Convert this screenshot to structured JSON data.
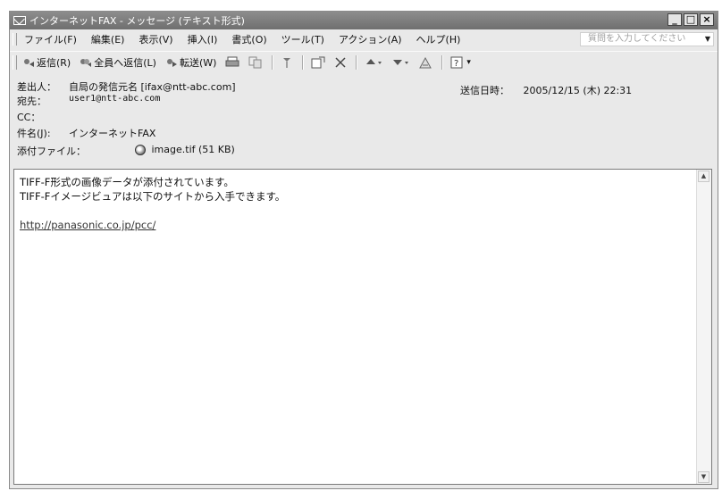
{
  "window": {
    "title": "インターネットFAX - メッセージ (テキスト形式)",
    "controls": {
      "minimize": "_",
      "maximize": "□",
      "close": "×"
    }
  },
  "menu": {
    "items": [
      "ファイル(F)",
      "編集(E)",
      "表示(V)",
      "挿入(I)",
      "書式(O)",
      "ツール(T)",
      "アクション(A)",
      "ヘルプ(H)"
    ],
    "help_placeholder": "質問を入力してください"
  },
  "toolbar": {
    "reply": "返信(R)",
    "reply_all": "全員へ返信(L)",
    "forward": "転送(W)"
  },
  "header": {
    "from_label": "差出人：",
    "from_value": "自局の発信元名 [ifax@ntt-abc.com]",
    "sent_label": "送信日時：",
    "sent_value": "2005/12/15 (木) 22:31",
    "to_label": "宛先：",
    "to_value": "user1@ntt-abc.com",
    "cc_label": "CC：",
    "cc_value": "",
    "subject_label": "件名(J):",
    "subject_value": "インターネットFAX",
    "attachment_label": "添付ファイル：",
    "attachment_name": "image.tif",
    "attachment_size": "(51 KB)"
  },
  "body": {
    "line1": "TIFF-F形式の画像データが添付されています。",
    "line2": "TIFF-Fイメージビュアは以下のサイトから入手できます。",
    "link": "http://panasonic.co.jp/pcc/"
  },
  "scrollbar": {
    "up": "▲",
    "down": "▼"
  }
}
